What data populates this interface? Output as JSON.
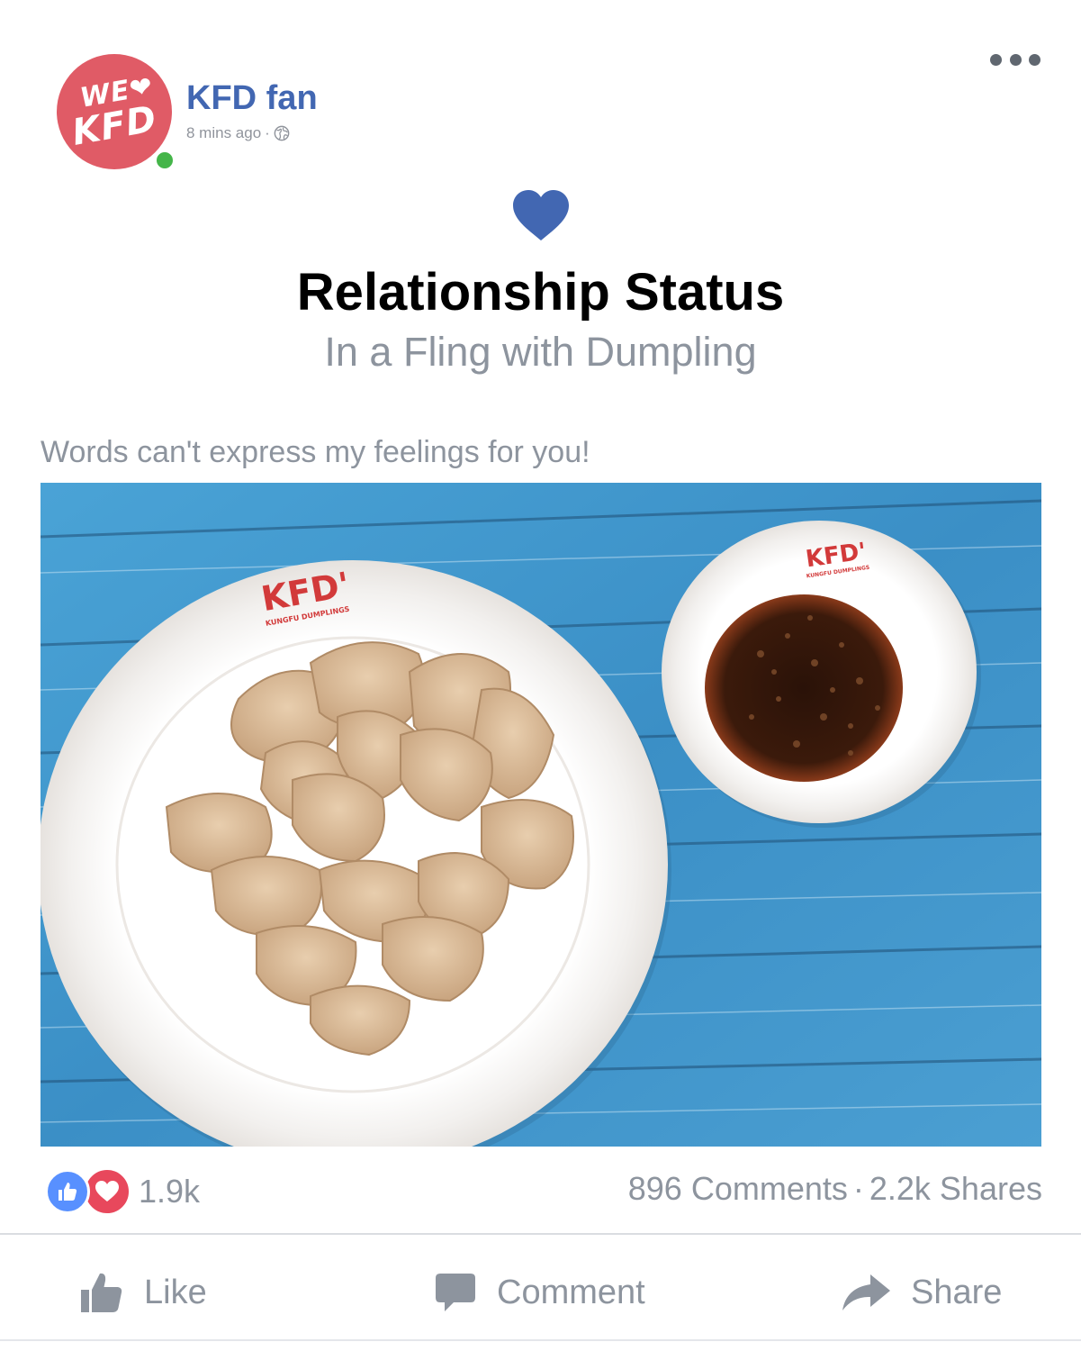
{
  "post": {
    "author": {
      "name": "KFD fan",
      "avatar_text_line1": "WE",
      "avatar_text_line2": "KFD",
      "time": "8 mins ago",
      "privacy_icon": "globe-icon"
    },
    "more_icon": "more-dots-icon",
    "life_event": {
      "icon": "heart-icon",
      "title": "Relationship Status",
      "subtitle": "In a Fling with Dumpling"
    },
    "caption": "Words can't express my feelings for you!",
    "photo": {
      "plate_brand": "KFD'",
      "plate_tagline": "KUNGFU DUMPLINGS",
      "bowl_brand": "KFD'",
      "bowl_tagline": "KUNGFU DUMPLINGS"
    },
    "reactions": {
      "icons": [
        "like-reaction-icon",
        "love-reaction-icon"
      ],
      "count": "1.9k"
    },
    "stats": {
      "comments": "896 Comments",
      "separator": "·",
      "shares": "2.2k Shares"
    },
    "actions": {
      "like": "Like",
      "comment": "Comment",
      "share": "Share"
    }
  },
  "colors": {
    "brand_blue": "#4267b2",
    "muted_gray": "#8d949e",
    "avatar_red": "#e05b66",
    "online_green": "#44b549",
    "love_red": "#e8485c",
    "like_blue": "#5890ff"
  }
}
